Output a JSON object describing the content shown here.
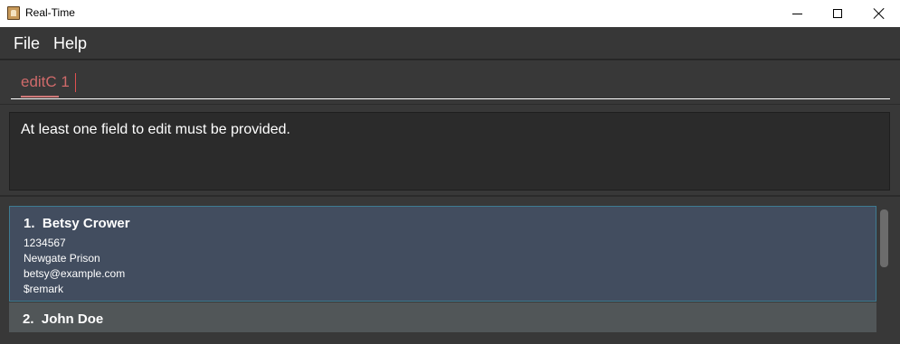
{
  "window": {
    "title": "Real-Time",
    "controls": {
      "minimize": "minimize-icon",
      "maximize": "maximize-icon",
      "close": "close-icon"
    }
  },
  "menu": {
    "items": [
      "File",
      "Help"
    ]
  },
  "command_box": {
    "value": "editC 1"
  },
  "result_display": {
    "text": "At least one field to edit must be provided."
  },
  "person_list": {
    "persons": [
      {
        "index": "1.",
        "name": "Betsy Crower",
        "phone": "1234567",
        "address": "Newgate Prison",
        "email": "betsy@example.com",
        "remark": "$remark",
        "selected": true
      },
      {
        "index": "2.",
        "name": "John Doe",
        "selected": false
      }
    ]
  },
  "colors": {
    "accent_selected_card": "#424d5f",
    "selected_border": "#3e7b91",
    "error_text": "#cf6a6a",
    "background": "#2b2b2b"
  }
}
